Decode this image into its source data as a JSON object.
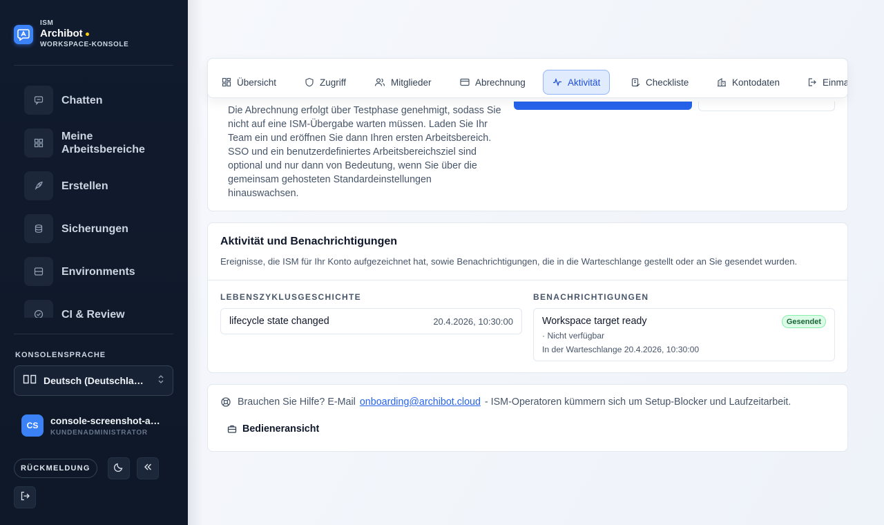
{
  "brand": {
    "eyebrow": "ISM",
    "name": "Archibot",
    "subtitle": "WORKSPACE-KONSOLE"
  },
  "sidebar": {
    "items": [
      {
        "label": "Chatten",
        "icon": "chat-icon"
      },
      {
        "label": "Meine Arbeitsbereiche",
        "icon": "grid-icon"
      },
      {
        "label": "Erstellen",
        "icon": "rocket-icon"
      },
      {
        "label": "Sicherungen",
        "icon": "database-icon"
      },
      {
        "label": "Environments",
        "icon": "server-icon"
      },
      {
        "label": "CI & Review",
        "icon": "check-circle-icon"
      }
    ],
    "language_title": "KONSOLENSPRACHE",
    "language_value": "Deutsch (Deutschland)",
    "user": {
      "initials": "CS",
      "name": "console-screenshot-admin",
      "role": "KUNDENADMINISTRATOR"
    },
    "feedback_label": "RÜCKMELDUNG"
  },
  "tabs": [
    {
      "label": "Übersicht",
      "icon": "dashboard-icon",
      "active": false
    },
    {
      "label": "Zugriff",
      "icon": "shield-icon",
      "active": false
    },
    {
      "label": "Mitglieder",
      "icon": "users-icon",
      "active": false
    },
    {
      "label": "Abrechnung",
      "icon": "credit-card-icon",
      "active": false
    },
    {
      "label": "Aktivität",
      "icon": "activity-icon",
      "active": true
    },
    {
      "label": "Checkliste",
      "icon": "clipboard-icon",
      "active": false
    },
    {
      "label": "Kontodaten",
      "icon": "building-icon",
      "active": false
    },
    {
      "label": "Einma",
      "icon": "sign-in-icon",
      "active": false
    }
  ],
  "intro": {
    "text": "Die Abrechnung erfolgt über Testphase genehmigt, sodass Sie nicht auf eine ISM-Übergabe warten müssen. Laden Sie Ihr Team ein und eröffnen Sie dann Ihren ersten Arbeitsbereich. SSO und ein benutzerdefiniertes Arbeitsbereichsziel sind optional und nur dann von Bedeutung, wenn Sie über die gemeinsam gehosteten Standardeinstellungen hinauswachsen."
  },
  "activity": {
    "title": "Aktivität und Benachrichtigungen",
    "description": "Ereignisse, die ISM für Ihr Konto aufgezeichnet hat, sowie Benachrichtigungen, die in die Warteschlange gestellt oder an Sie gesendet wurden.",
    "lifecycle_title": "LEBENSZYKLUSGESCHICHTE",
    "lifecycle": [
      {
        "event": "lifecycle state changed",
        "time": "20.4.2026, 10:30:00"
      }
    ],
    "notifications_title": "BENACHRICHTIGUNGEN",
    "notifications": [
      {
        "title": "Workspace target ready",
        "status": "Gesendet",
        "channel": "· Nicht verfügbar",
        "queued": "In der Warteschlange 20.4.2026, 10:30:00"
      }
    ]
  },
  "help": {
    "prefix": "Brauchen Sie Hilfe? E-Mail",
    "email": "onboarding@archibot.cloud",
    "suffix": "- ISM-Operatoren kümmern sich um Setup-Blocker und Laufzeitarbeit.",
    "operator_button": "Bedieneransicht"
  },
  "colors": {
    "accent": "#2563eb",
    "sidebar_bg": "#111b2e",
    "badge_green": "#166534"
  }
}
